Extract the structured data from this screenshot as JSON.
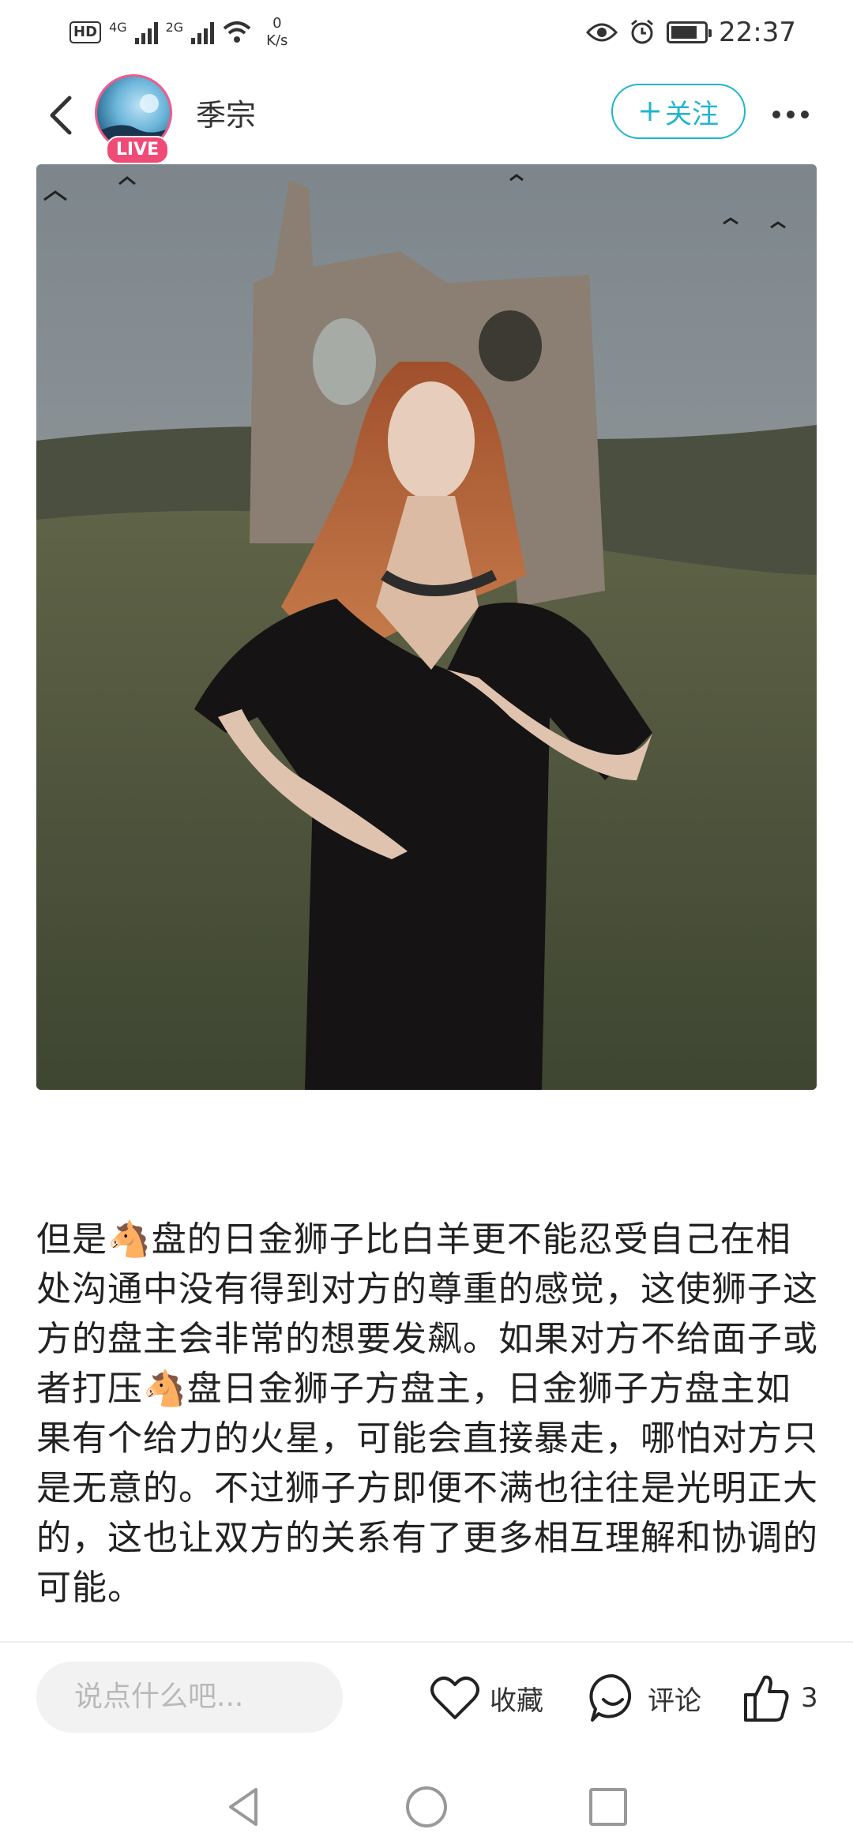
{
  "status_bar": {
    "hd_label": "HD",
    "sim1": "4G",
    "sim2": "2G",
    "net_speed_value": "0",
    "net_speed_unit": "K/s",
    "time": "22:37"
  },
  "header": {
    "username": "季宗",
    "live_badge": "LIVE",
    "follow_label": "关注"
  },
  "post": {
    "body": "但是🐴盘的日金狮子比白羊更不能忍受自己在相处沟通中没有得到对方的尊重的感觉，这使狮子这方的盘主会非常的想要发飙。如果对方不给面子或者打压🐴盘日金狮子方盘主，日金狮子方盘主如果有个给力的火星，可能会直接暴走，哪怕对方只是无意的。不过狮子方即便不满也往往是光明正大的，这也让双方的关系有了更多相互理解和协调的可能。"
  },
  "actions": {
    "comment_placeholder": "说点什么吧...",
    "collect_label": "收藏",
    "comment_label": "评论",
    "like_count": "3"
  },
  "colors": {
    "accent": "#20b5cf",
    "live": "#f04a77"
  },
  "icons": {
    "back": "chevron-left-icon",
    "more": "more-dots-icon",
    "collect": "heart-icon",
    "comment": "speech-bubble-icon",
    "like": "thumbs-up-icon"
  }
}
